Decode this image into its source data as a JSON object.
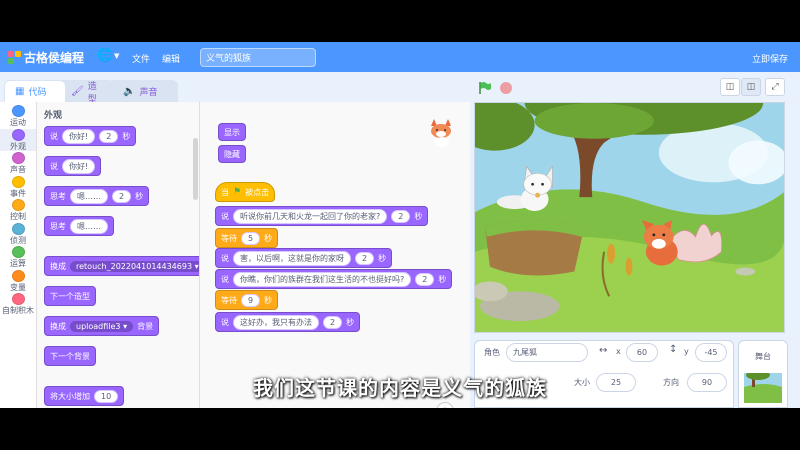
{
  "menubar": {
    "logo_text": "古格侯编程",
    "file_label": "文件",
    "edit_label": "编辑",
    "project_title": "义气的狐族",
    "save_now_label": "立即保存"
  },
  "tabs": {
    "code": "代码",
    "costumes": "造型",
    "sounds": "声音"
  },
  "categories": [
    {
      "label": "运动",
      "color": "#4c97ff"
    },
    {
      "label": "外观",
      "color": "#9966ff"
    },
    {
      "label": "声音",
      "color": "#cf63cf"
    },
    {
      "label": "事件",
      "color": "#ffbf00"
    },
    {
      "label": "控制",
      "color": "#ffab19"
    },
    {
      "label": "侦测",
      "color": "#5cb1d6"
    },
    {
      "label": "运算",
      "color": "#59c059"
    },
    {
      "label": "变量",
      "color": "#ff8c1a"
    },
    {
      "label": "自制积木",
      "color": "#ff6680"
    }
  ],
  "palette": {
    "heading": "外观",
    "say_secs": {
      "verb": "说",
      "text": "你好!",
      "secs": "2",
      "unit": "秒"
    },
    "say": {
      "verb": "说",
      "text": "你好!"
    },
    "think_secs": {
      "verb": "思考",
      "text": "嗯……",
      "secs": "2",
      "unit": "秒"
    },
    "think": {
      "verb": "思考",
      "text": "嗯……"
    },
    "switch_costume": {
      "verb": "换成",
      "value": "retouch_2022041014434693",
      "suffix": "造型"
    },
    "next_costume": "下一个造型",
    "switch_backdrop": {
      "verb": "换成",
      "value": "uploadfile3",
      "suffix": "背景"
    },
    "next_backdrop": "下一个背景",
    "change_size": {
      "text": "将大小增加",
      "value": "10"
    }
  },
  "script": {
    "show": "显示",
    "hide": "隐藏",
    "hat": {
      "prefix": "当",
      "suffix": "被点击"
    },
    "say1": {
      "verb": "说",
      "text": "听说你前几天和火龙一起回了你的老家?",
      "secs": "2",
      "unit": "秒"
    },
    "wait1": {
      "verb": "等待",
      "value": "5",
      "unit": "秒"
    },
    "say2": {
      "verb": "说",
      "text": "害，以后啊，这就是你的家呀",
      "secs": "2",
      "unit": "秒"
    },
    "say3": {
      "verb": "说",
      "text": "你瞧，你们的族群在我们这生活的不也挺好吗?",
      "secs": "2",
      "unit": "秒"
    },
    "wait2": {
      "verb": "等待",
      "value": "9",
      "unit": "秒"
    },
    "say4": {
      "verb": "说",
      "text": "这好办，我只有办法",
      "secs": "2",
      "unit": "秒"
    }
  },
  "sprite_info": {
    "sprite_label": "角色",
    "sprite_name": "九尾狐",
    "x_label": "x",
    "x_value": "60",
    "y_label": "y",
    "y_value": "-45",
    "size_label": "大小",
    "size_value": "25",
    "direction_label": "方向",
    "direction_value": "90"
  },
  "stage_panel": {
    "label": "舞台"
  },
  "subtitle": "我们这节课的内容是义气的狐族",
  "colors": {
    "accent": "#4c97ff",
    "looks": "#9966ff",
    "events": "#ffbf00",
    "control": "#ffab19"
  },
  "icons": [
    "globe-icon",
    "brush-icon",
    "speaker-icon",
    "code-icon",
    "green-flag-icon",
    "stop-icon",
    "zoom-in-icon",
    "fullscreen-icon"
  ]
}
